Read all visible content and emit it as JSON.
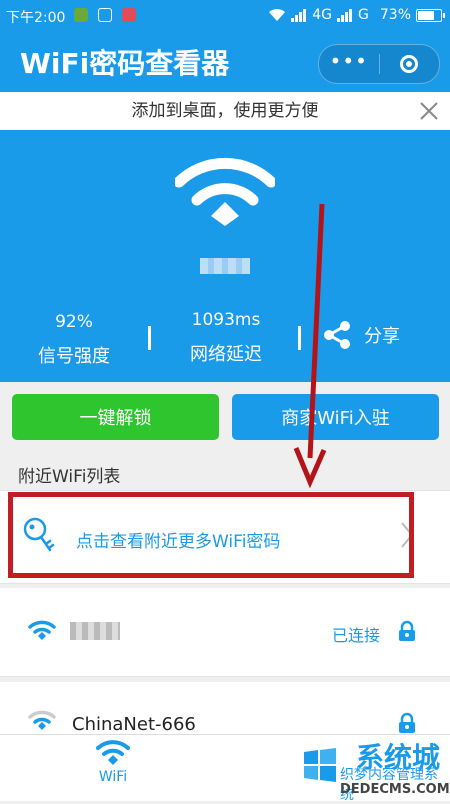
{
  "status_bar": {
    "time": "下午2:00",
    "network": "4G",
    "carrier": "G",
    "battery": "73%"
  },
  "app": {
    "title": "WiFi密码查看器"
  },
  "add_banner": {
    "text": "添加到桌面，使用更方便"
  },
  "current_wifi": {
    "signal_value": "92%",
    "signal_label": "信号强度",
    "latency_value": "1093ms",
    "latency_label": "网络延迟",
    "share_label": "分享"
  },
  "actions": {
    "unlock_label": "一键解锁",
    "merchant_label": "商家WiFi入驻"
  },
  "nearby": {
    "section_title": "附近WiFi列表",
    "more_text": "点击查看附近更多WiFi密码",
    "list": [
      {
        "ssid": "",
        "status": "已连接"
      },
      {
        "ssid": "ChinaNet-666",
        "status": ""
      }
    ]
  },
  "tab_bar": {
    "wifi_label": "WiFi"
  },
  "watermark": {
    "brand": "系统城",
    "line1": "织梦内容管理系统",
    "line2": "DEDECMS.COM"
  },
  "colors": {
    "primary": "#1a9bea",
    "green": "#2ec52e",
    "highlight": "#c11d22"
  }
}
